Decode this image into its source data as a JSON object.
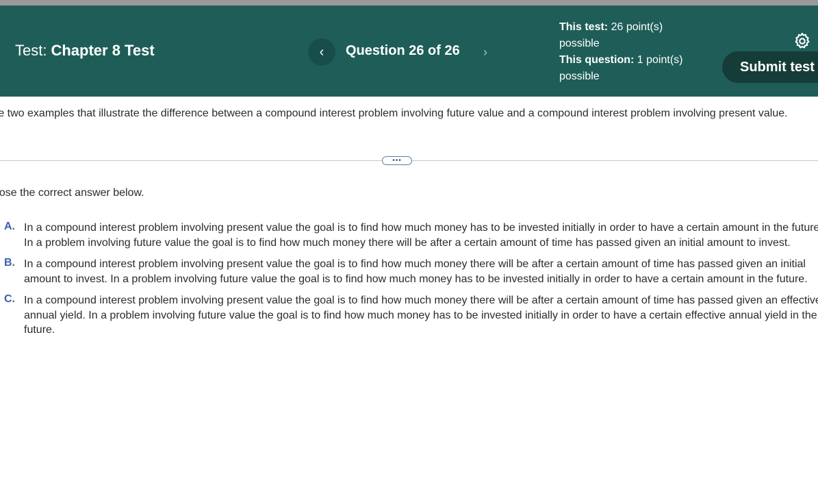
{
  "header": {
    "test_prefix": "Test:",
    "test_name": "Chapter 8 Test",
    "question_label": "Question 26 of 26",
    "prev_symbol": "‹",
    "next_symbol": "›",
    "points": {
      "test_label": "This test:",
      "test_value": "26 point(s) possible",
      "question_label": "This question:",
      "question_value": "1 point(s) possible"
    },
    "settings_icon": "gear-icon",
    "submit_label": "Submit test"
  },
  "colors": {
    "header_bg": "#1f5e58",
    "submit_bg": "#163c39",
    "option_letter": "#3d61a8"
  },
  "question": {
    "prompt": "re two examples that illustrate the difference between a compound interest problem involving future value and a compound interest problem involving present value.",
    "handle_symbol": "•••",
    "instruction": "oose the correct answer below.",
    "options": [
      {
        "letter": "A.",
        "text": "In a compound interest problem involving present value the goal is to find how much money has to be invested initially in order to have a certain amount in the future. In a problem involving future value the goal is to find how much money there will be after a certain amount of time has passed given an initial amount to invest."
      },
      {
        "letter": "B.",
        "text": "In a compound interest problem involving present value the goal is to find how much money there will be after a certain amount of time has passed given an initial amount to invest. In a problem involving future value the goal is to find how much money has to be invested initially in order to have a certain amount in the future."
      },
      {
        "letter": "C.",
        "text": "In a compound interest problem involving present value the goal is to find how much money there will be after a certain amount of time has passed given an effective annual yield. In a problem involving future value the goal is to find how much money has to be invested initially in order to have a certain effective annual yield in the future."
      }
    ]
  }
}
